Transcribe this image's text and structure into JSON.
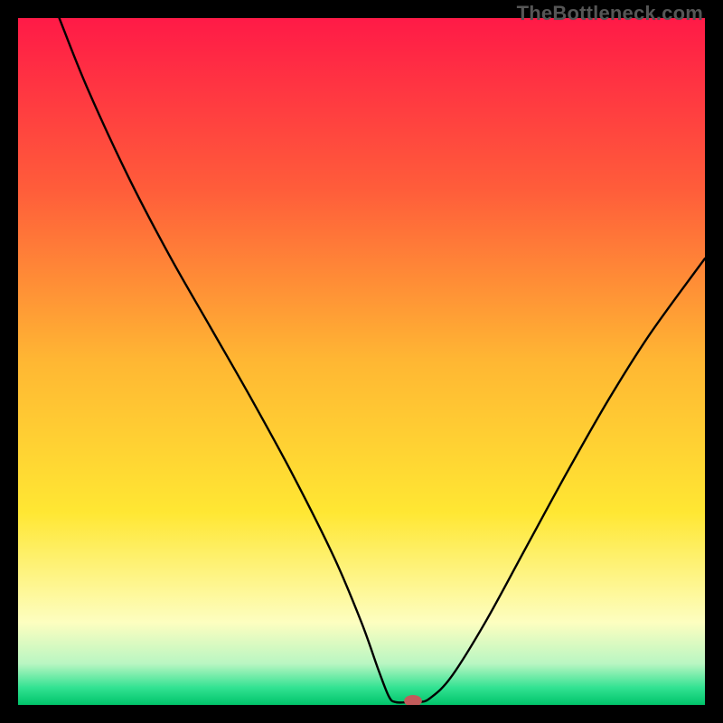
{
  "watermark": "TheBottleneck.com",
  "chart_data": {
    "type": "line",
    "title": "",
    "xlabel": "",
    "ylabel": "",
    "xlim": [
      0,
      100
    ],
    "ylim": [
      0,
      100
    ],
    "grid": false,
    "legend": false,
    "background_gradient": {
      "stops": [
        {
          "offset": 0.0,
          "color": "#ff1a47"
        },
        {
          "offset": 0.25,
          "color": "#ff5d3a"
        },
        {
          "offset": 0.5,
          "color": "#ffb733"
        },
        {
          "offset": 0.72,
          "color": "#ffe733"
        },
        {
          "offset": 0.88,
          "color": "#fdfec0"
        },
        {
          "offset": 0.94,
          "color": "#b9f6c2"
        },
        {
          "offset": 0.975,
          "color": "#32e292"
        },
        {
          "offset": 1.0,
          "color": "#00c46a"
        }
      ]
    },
    "series": [
      {
        "name": "bottleneck-curve",
        "color": "#000000",
        "width": 2.4,
        "points": [
          {
            "x": 6.0,
            "y": 100.0
          },
          {
            "x": 10.0,
            "y": 90.0
          },
          {
            "x": 16.0,
            "y": 77.0
          },
          {
            "x": 22.0,
            "y": 65.5
          },
          {
            "x": 28.0,
            "y": 55.0
          },
          {
            "x": 34.0,
            "y": 44.5
          },
          {
            "x": 40.0,
            "y": 33.5
          },
          {
            "x": 46.0,
            "y": 21.5
          },
          {
            "x": 50.0,
            "y": 12.0
          },
          {
            "x": 52.5,
            "y": 5.0
          },
          {
            "x": 54.0,
            "y": 1.2
          },
          {
            "x": 55.0,
            "y": 0.4
          },
          {
            "x": 57.0,
            "y": 0.4
          },
          {
            "x": 58.5,
            "y": 0.4
          },
          {
            "x": 60.0,
            "y": 1.0
          },
          {
            "x": 63.0,
            "y": 4.0
          },
          {
            "x": 68.0,
            "y": 12.0
          },
          {
            "x": 74.0,
            "y": 23.0
          },
          {
            "x": 80.0,
            "y": 34.0
          },
          {
            "x": 86.0,
            "y": 44.5
          },
          {
            "x": 92.0,
            "y": 54.0
          },
          {
            "x": 100.0,
            "y": 65.0
          }
        ]
      }
    ],
    "marker": {
      "name": "optimal-point",
      "x": 57.5,
      "y": 0.6,
      "rx_pct": 1.3,
      "ry_pct": 0.85,
      "fill": "#c25b5b"
    }
  }
}
